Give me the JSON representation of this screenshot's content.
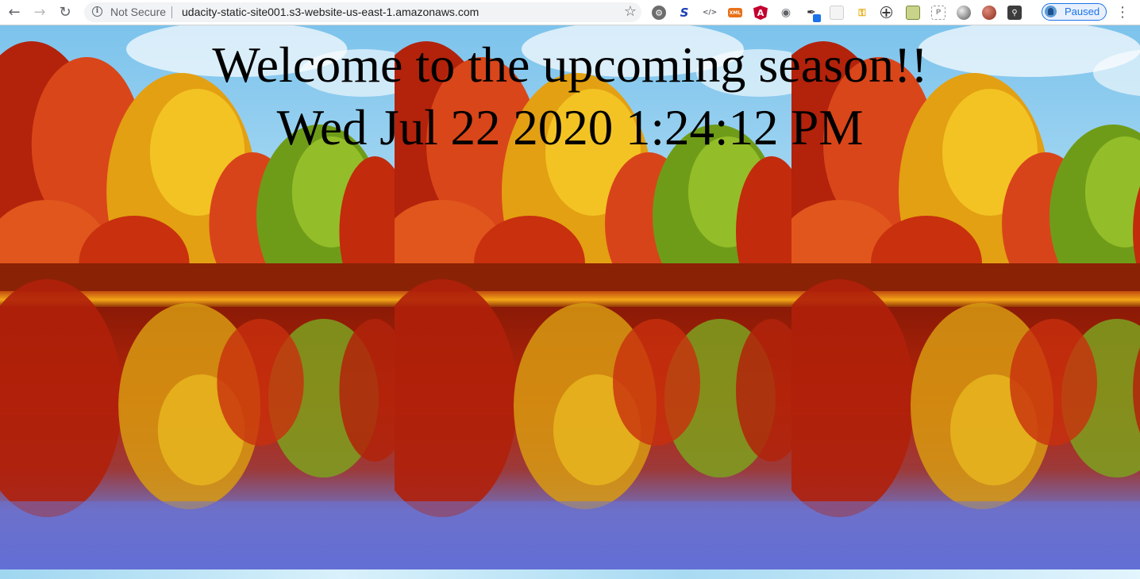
{
  "browser": {
    "security_label": "Not Secure",
    "url": "udacity-static-site001.s3-website-us-east-1.amazonaws.com",
    "profile_status": "Paused",
    "extensions": [
      {
        "name": "gear-extension-icon"
      },
      {
        "name": "s-extension-icon",
        "label": "S"
      },
      {
        "name": "code-extension-icon",
        "label": "</>"
      },
      {
        "name": "xml-extension-icon",
        "label": "XML"
      },
      {
        "name": "angular-extension-icon",
        "label": "A"
      },
      {
        "name": "robot-extension-icon"
      },
      {
        "name": "eyedropper-extension-icon"
      },
      {
        "name": "grid-extension-icon"
      },
      {
        "name": "key-extension-icon"
      },
      {
        "name": "plus-extension-icon"
      },
      {
        "name": "note-extension-icon"
      },
      {
        "name": "screenshot-extension-icon"
      },
      {
        "name": "circle-extension-icon"
      },
      {
        "name": "ball-extension-icon"
      },
      {
        "name": "shield-extension-icon"
      }
    ]
  },
  "page": {
    "heading": "Welcome to the upcoming season!!",
    "datetime": "Wed Jul 22 2020 1:24:12 PM",
    "background": "autumn-lake-image"
  },
  "colors": {
    "link_blue": "#1a73e8",
    "omnibox_bg": "#f1f3f4"
  }
}
